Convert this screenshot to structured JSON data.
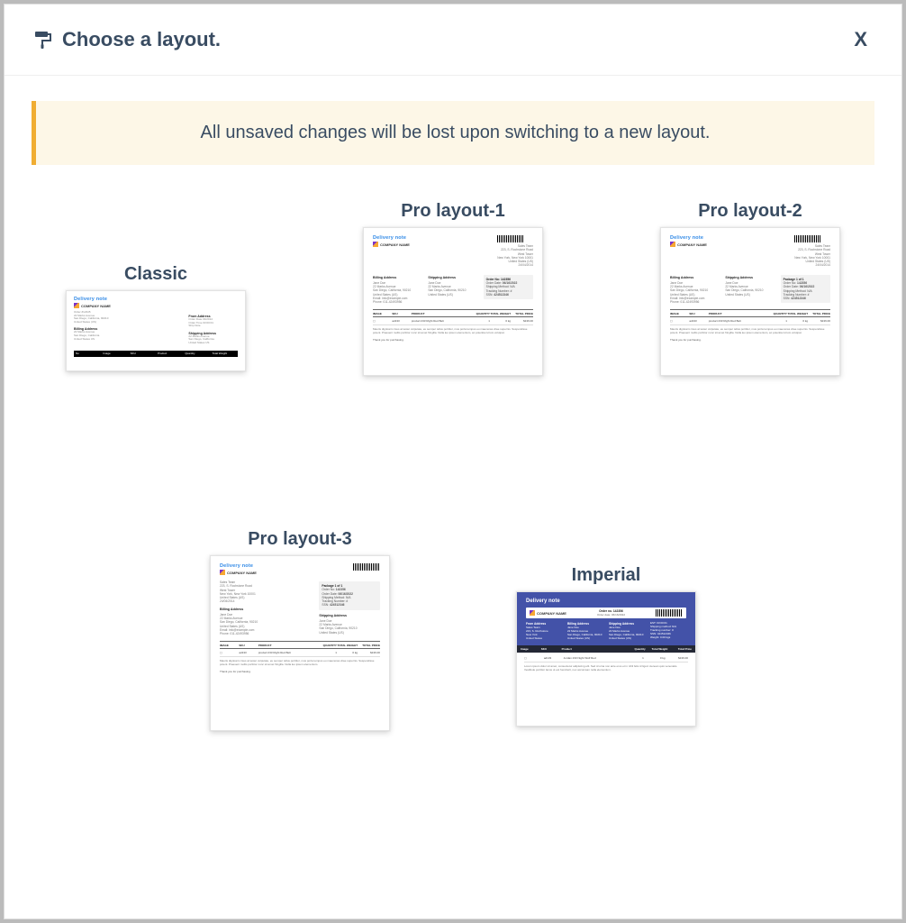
{
  "header": {
    "title": "Choose a layout.",
    "close": "X"
  },
  "alert": "All unsaved changes will be lost upon switching to a new layout.",
  "layouts": [
    {
      "id": "classic",
      "label": "Classic"
    },
    {
      "id": "pro1",
      "label": "Pro layout-1"
    },
    {
      "id": "pro2",
      "label": "Pro layout-2"
    },
    {
      "id": "pro3",
      "label": "Pro layout-3"
    },
    {
      "id": "imperial",
      "label": "Imperial"
    }
  ],
  "thumb": {
    "delivery_note": "Delivery note",
    "company": "COMPANY NAME",
    "order_no": "Order no. 142356",
    "billing": "Billing Address",
    "shipping": "Shipping Address",
    "package": "Package 1 of 1",
    "thanks": "Thank you for purchasing.",
    "table": {
      "h1": "IMAGE",
      "h2": "SKU",
      "h3": "PRODUCT",
      "h4": "QUANTITY",
      "h5": "TOTAL WEIGHT",
      "h6": "TOTAL PRICE",
      "r1c2": "ad133",
      "r1c3": "product 233 Right Red Belt",
      "r1c4": "1",
      "r1c5": "0 kg",
      "r1c6": "$136.00"
    }
  }
}
